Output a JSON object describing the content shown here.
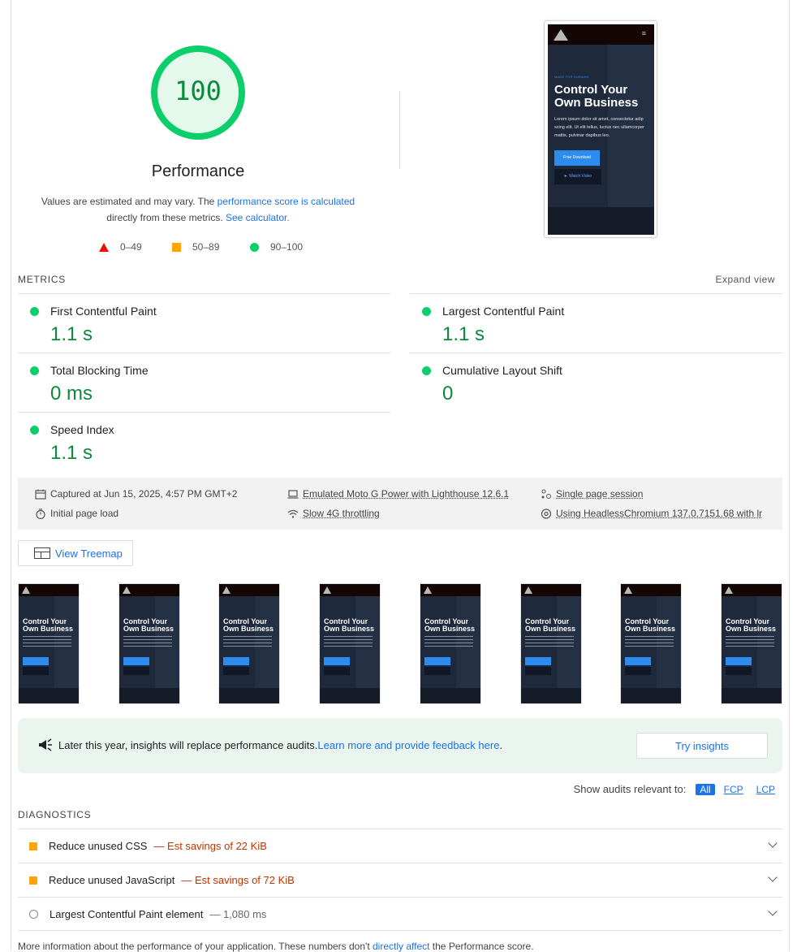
{
  "score": {
    "value": "100",
    "label": "Performance",
    "percent": 100
  },
  "description": {
    "prefix": "Values are estimated and may vary. The ",
    "link1": "performance score is calculated",
    "middle": "directly from these metrics. ",
    "link2": "See calculator."
  },
  "legend": {
    "fail": "0–49",
    "average": "50–89",
    "pass": "90–100"
  },
  "phone_preview": {
    "tagline": "MADE FOR HUMANS",
    "title": "Control Your Own Business",
    "body": "Lorem ipsum dolor sit amet, consectetur adip scing elit. Ut elit tellus, luctus nec ullamcorper mattis, pulvinar dapibus leo.",
    "primary_button": "Free Download",
    "secondary_button": "► Watch Video",
    "menu_glyph": "≡"
  },
  "metrics": {
    "section_title": "METRICS",
    "expand_label": "Expand view",
    "items": [
      {
        "label": "First Contentful Paint",
        "value": "1.1 s"
      },
      {
        "label": "Largest Contentful Paint",
        "value": "1.1 s"
      },
      {
        "label": "Total Blocking Time",
        "value": "0 ms"
      },
      {
        "label": "Cumulative Layout Shift",
        "value": "0"
      },
      {
        "label": "Speed Index",
        "value": "1.1 s"
      }
    ]
  },
  "runtime": {
    "captured": "Captured at Jun 15, 2025, 4:57 PM GMT+2",
    "initial_load": "Initial page load",
    "device": "Emulated Moto G Power with Lighthouse 12.6.1",
    "throttling": "Slow 4G throttling",
    "session": "Single page session",
    "browser": "Using HeadlessChromium 137.0.7151.68 with lr"
  },
  "treemap_button": "View Treemap",
  "filmstrip": {
    "frame_title": "Control Your Own Business",
    "count": 8
  },
  "insights": {
    "message": "Later this year, insights will replace performance audits. ",
    "link": "Learn more and provide feedback here",
    "suffix": ".",
    "button": "Try insights"
  },
  "filter": {
    "label": "Show audits relevant to:",
    "options": [
      "All",
      "FCP",
      "LCP"
    ]
  },
  "diagnostics": {
    "section_title": "DIAGNOSTICS",
    "items": [
      {
        "title": "Reduce unused CSS",
        "savings": "— Est savings of 22 KiB"
      },
      {
        "title": "Reduce unused JavaScript",
        "savings": "— Est savings of 72 KiB"
      },
      {
        "title": "Largest Contentful Paint element",
        "savings": "— 1,080 ms"
      }
    ]
  },
  "footer": {
    "prefix": "More information about the performance of your application. These numbers don't ",
    "link": "directly affect",
    "suffix": " the Performance score."
  },
  "colors": {
    "pass": "#0cce6b",
    "pass_text": "#0c8a3c",
    "average": "#ffa400",
    "fail": "#eb0f00",
    "link": "#1a73e8"
  }
}
